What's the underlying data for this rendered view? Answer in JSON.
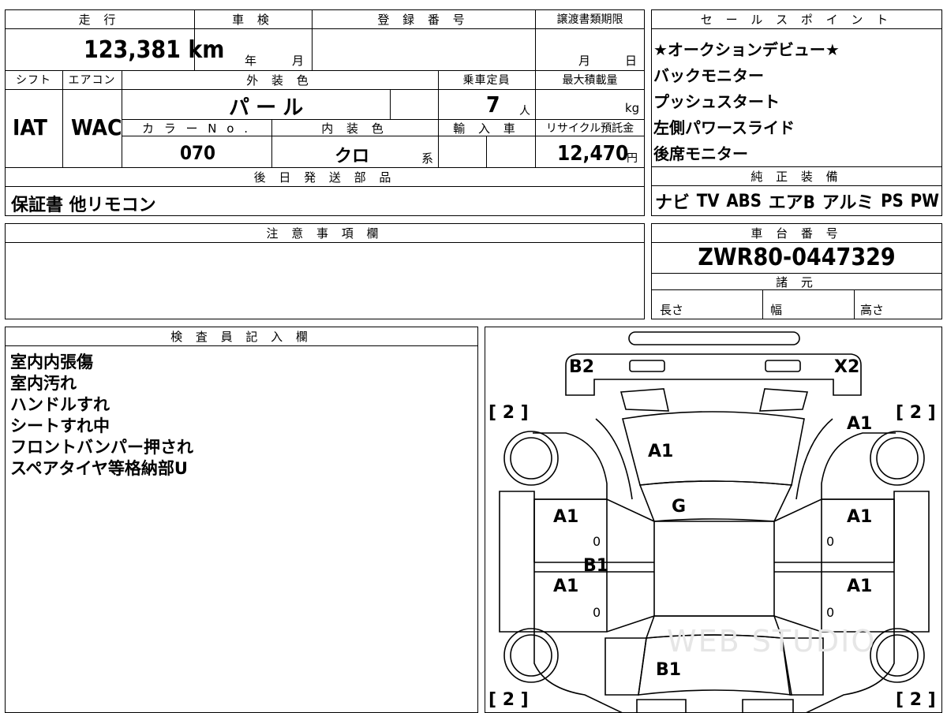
{
  "top_table": {
    "headers": {
      "mileage": "走 行",
      "inspection": "車 検",
      "registration": "登 録 番 号",
      "deadline": "譲渡書類期限",
      "shift": "シフト",
      "aircon": "エアコン",
      "exterior": "外 装 色",
      "capacity": "乗車定員",
      "max_load": "最大積載量",
      "color_no": "カ ラ ー  N o .",
      "interior": "内 装 色",
      "import": "輸 入 車",
      "recycle": "リサイクル預託金",
      "accessories": "後 日 発 送 部 品"
    },
    "mileage_value": "123,381 km",
    "inspection_year": "年",
    "inspection_month": "月",
    "deadline_month": "月",
    "deadline_day": "日",
    "shift_value": "IAT",
    "aircon_value": "WAC",
    "exterior_value": "パ ー ル",
    "capacity_value": "7",
    "capacity_unit": "人",
    "max_load_unit": "kg",
    "color_no_value": "070",
    "interior_value": "クロ",
    "interior_suffix": "系",
    "recycle_value": "12,470",
    "recycle_unit": "円",
    "accessories_value": "保証書  他リモコン"
  },
  "sales_points": {
    "header": "セ ー ル ス ポ イ ン ト",
    "items": [
      "★オークションデビュー★",
      "バックモニター",
      "プッシュスタート",
      "左側パワースライド",
      "後席モニター"
    ]
  },
  "equipment": {
    "header": "純 正 装 備",
    "items": [
      "ナビ",
      "TV",
      "ABS",
      "エアB",
      "アルミ",
      "PS",
      "PW"
    ]
  },
  "notes": {
    "header": "注 意 事 項 欄"
  },
  "chassis": {
    "header": "車 台 番 号",
    "value": "ZWR80-0447329"
  },
  "specs": {
    "header": "諸 元",
    "length": "長さ",
    "width": "幅",
    "height": "高さ"
  },
  "inspector": {
    "header": "検 査 員 記 入 欄",
    "lines": [
      "室内内張傷",
      "室内汚れ",
      "ハンドルすれ",
      "シートすれ中",
      "フロントバンパー押され",
      "スペアタイヤ等格納部U"
    ]
  },
  "diagram": {
    "marks": {
      "b2": "B2",
      "x2": "X2",
      "tl_bracket": "[ 2 ]",
      "tr_bracket": "[ 2 ]",
      "hood": "A1",
      "front_right_fender": "A1",
      "roof_front": "G",
      "front_left_door": "A1",
      "front_right_door": "A1",
      "rear_left_door": "A1",
      "rear_right_door": "A1",
      "pillar_left": "B1",
      "rear": "B1",
      "zero1": "0",
      "zero2": "0",
      "zero3": "0",
      "zero4": "0",
      "bl_bracket": "[ 2 ]",
      "br_bracket": "[ 2 ]"
    },
    "watermark": "WEB STUDIO"
  }
}
